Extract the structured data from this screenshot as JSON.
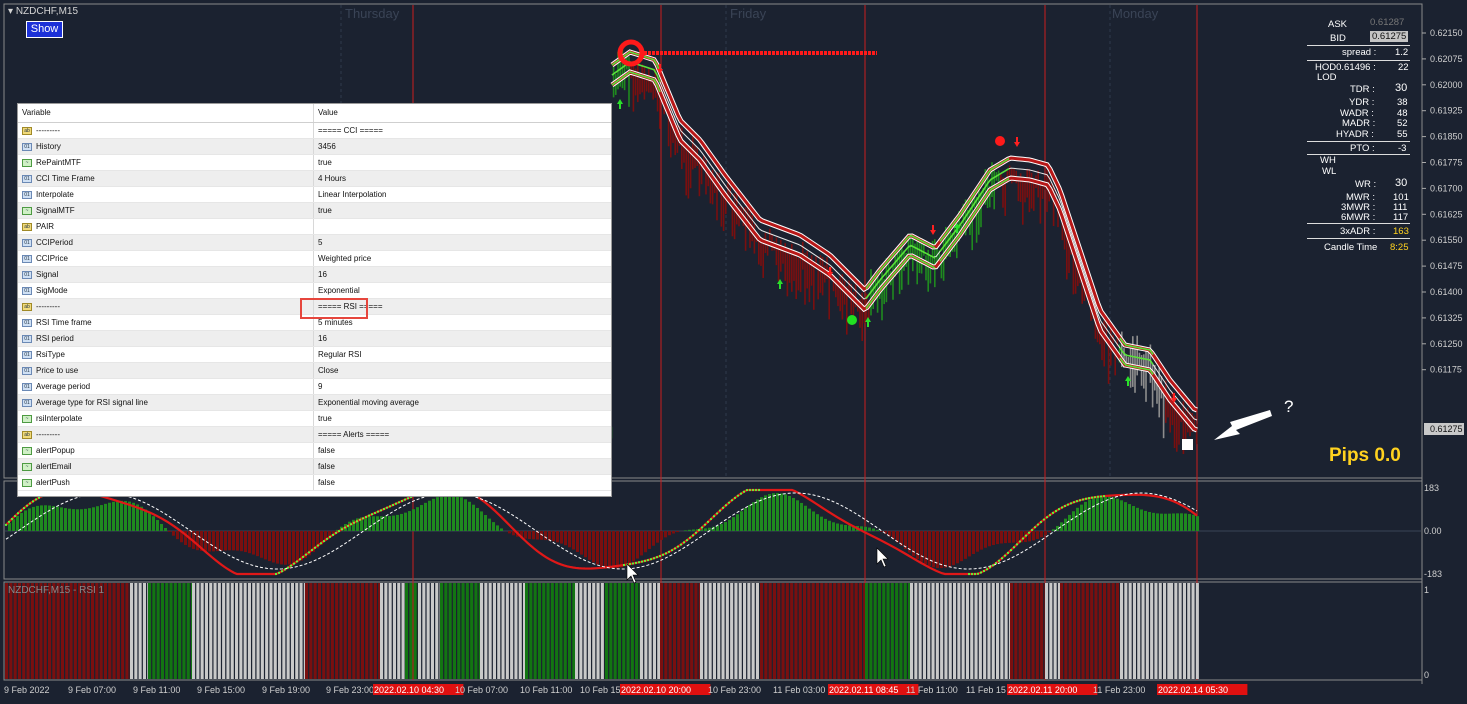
{
  "window": {
    "symbol_title": "NZDCHF,M15",
    "show_button": "Show",
    "rsi_subwindow_label": "NZDCHF,M15 - RSI 1"
  },
  "sessions": [
    "Thursday",
    "Friday",
    "Monday"
  ],
  "price_axis": [
    "0.62150",
    "0.62075",
    "0.62000",
    "0.61925",
    "0.61850",
    "0.61775",
    "0.61700",
    "0.61625",
    "0.61550",
    "0.61475",
    "0.61400",
    "0.61325",
    "0.61250",
    "0.61175"
  ],
  "current_price": "0.61275",
  "osc_axis": [
    "183",
    "0.00",
    "-183"
  ],
  "rsi_axis": [
    "1",
    "0"
  ],
  "time_axis": [
    "9 Feb 2022",
    "9 Feb 07:00",
    "9 Feb 11:00",
    "9 Feb 15:00",
    "9 Feb 19:00",
    "9 Feb 23:00",
    "2022.02.10 04:30",
    "10 Feb 07:00",
    "10 Feb 11:00",
    "10 Feb 15",
    "2022.02.10 20:00",
    "10 Feb 23:00",
    "11 Feb 03:00",
    "2022.02.11 08:45",
    "11 Feb 11:00",
    "11 Feb 15",
    "2022.02.11 20:00",
    "11 Feb 23:00",
    "2022.02.14 05:30"
  ],
  "info_panel": {
    "ask_label": "ASK",
    "ask_value": "0.61287",
    "bid_label": "BID",
    "bid_value": "0.61275",
    "spread_label": "spread :",
    "spread_value": "1.2",
    "hod_label": "HOD0.61496 :",
    "hod_value": "22",
    "lod_label": "LOD",
    "lod_value": "",
    "tdr_label": "TDR :",
    "tdr_value": "30",
    "ydr_label": "YDR :",
    "ydr_value": "38",
    "wadr_label": "WADR :",
    "wadr_value": "48",
    "madr_label": "MADR :",
    "madr_value": "52",
    "hyadr_label": "HYADR :",
    "hyadr_value": "55",
    "pto_label": "PTO :",
    "pto_value": "-3",
    "wh_label": "WH",
    "wl_label": "WL",
    "wr_label": "WR :",
    "wr_value": "30",
    "mwr_label": "MWR :",
    "mwr_value": "101",
    "mwr3_label": "3MWR :",
    "mwr3_value": "111",
    "mwr6_label": "6MWR :",
    "mwr6_value": "117",
    "adr3_label": "3xADR :",
    "adr3_value": "163",
    "candle_label": "Candle Time",
    "candle_value": "8:25"
  },
  "pips_label": "Pips 0.0",
  "question_mark": "?",
  "properties": {
    "header_variable": "Variable",
    "header_value": "Value",
    "rows": [
      {
        "icon": "ab",
        "name": "---------",
        "value": "===== CCI ====="
      },
      {
        "icon": "n",
        "name": "History",
        "value": "3456"
      },
      {
        "icon": "g",
        "name": "RePaintMTF",
        "value": "true"
      },
      {
        "icon": "n",
        "name": "CCI Time Frame",
        "value": "4 Hours"
      },
      {
        "icon": "n",
        "name": "Interpolate",
        "value": "Linear Interpolation"
      },
      {
        "icon": "g",
        "name": "SignalMTF",
        "value": "true"
      },
      {
        "icon": "ab",
        "name": "PAIR",
        "value": ""
      },
      {
        "icon": "n",
        "name": "CCIPeriod",
        "value": "5"
      },
      {
        "icon": "n",
        "name": "CCIPrice",
        "value": "Weighted price"
      },
      {
        "icon": "n",
        "name": "Signal",
        "value": "16"
      },
      {
        "icon": "n",
        "name": "SigMode",
        "value": "Exponential"
      },
      {
        "icon": "ab",
        "name": "---------",
        "value": "===== RSI ====="
      },
      {
        "icon": "n",
        "name": "RSI Time frame",
        "value": "5 minutes"
      },
      {
        "icon": "n",
        "name": "RSI period",
        "value": "16"
      },
      {
        "icon": "n",
        "name": "RsiType",
        "value": "Regular RSI"
      },
      {
        "icon": "n",
        "name": "Price to use",
        "value": "Close"
      },
      {
        "icon": "n",
        "name": "Average period",
        "value": "9"
      },
      {
        "icon": "n",
        "name": "Average type for RSI signal line",
        "value": "Exponential moving average"
      },
      {
        "icon": "g",
        "name": "rsiInterpolate",
        "value": "true"
      },
      {
        "icon": "ab",
        "name": "---------",
        "value": "===== Alerts ====="
      },
      {
        "icon": "g",
        "name": "alertPopup",
        "value": "false"
      },
      {
        "icon": "g",
        "name": "alertEmail",
        "value": "false"
      },
      {
        "icon": "g",
        "name": "alertPush",
        "value": "false"
      }
    ]
  },
  "colors": {
    "background": "#1b2230",
    "bull": "#1f8a1f",
    "bear": "#7a0f0f",
    "neutral": "#c8c8c8",
    "accent_yellow": "#ffd21f",
    "marker_red": "#ff1a1a",
    "line_green": "#5cff3c"
  }
}
